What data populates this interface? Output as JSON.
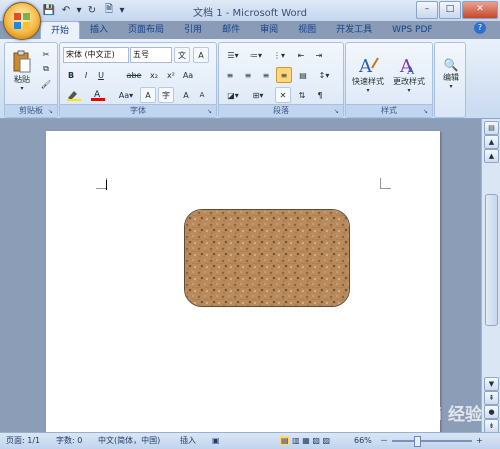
{
  "window": {
    "title": "文档 1 - Microsoft Word",
    "min": "–",
    "max": "□",
    "close": "✕"
  },
  "tabs": [
    "开始",
    "插入",
    "页面布局",
    "引用",
    "邮件",
    "审阅",
    "视图",
    "开发工具",
    "WPS PDF"
  ],
  "ribbon": {
    "clipboard": {
      "label": "剪贴板",
      "paste": "粘贴"
    },
    "font": {
      "label": "字体",
      "font_name": "宋体 (中文正)",
      "font_size": "五号",
      "bold": "B",
      "italic": "I",
      "underline": "U",
      "strike": "abe",
      "sub": "x₂",
      "sup": "x²",
      "clear": "Aa",
      "grow": "A",
      "shrink": "A",
      "border_char": "A",
      "phonetic": "文",
      "encircle": "字"
    },
    "paragraph": {
      "label": "段落"
    },
    "styles": {
      "label": "样式",
      "quick": "快速样式",
      "change": "更改样式"
    },
    "editing": {
      "label": "编辑",
      "edit": "编辑"
    }
  },
  "status": {
    "page": "页面: 1/1",
    "words": "字数: 0",
    "lang": "中文(简体，中国)",
    "mode": "插入",
    "zoom": "66%",
    "minus": "－",
    "plus": "+"
  },
  "watermark": "Bai 经验",
  "colors": {
    "accent": "#15428b",
    "shape_fill": "#b88a5c"
  }
}
